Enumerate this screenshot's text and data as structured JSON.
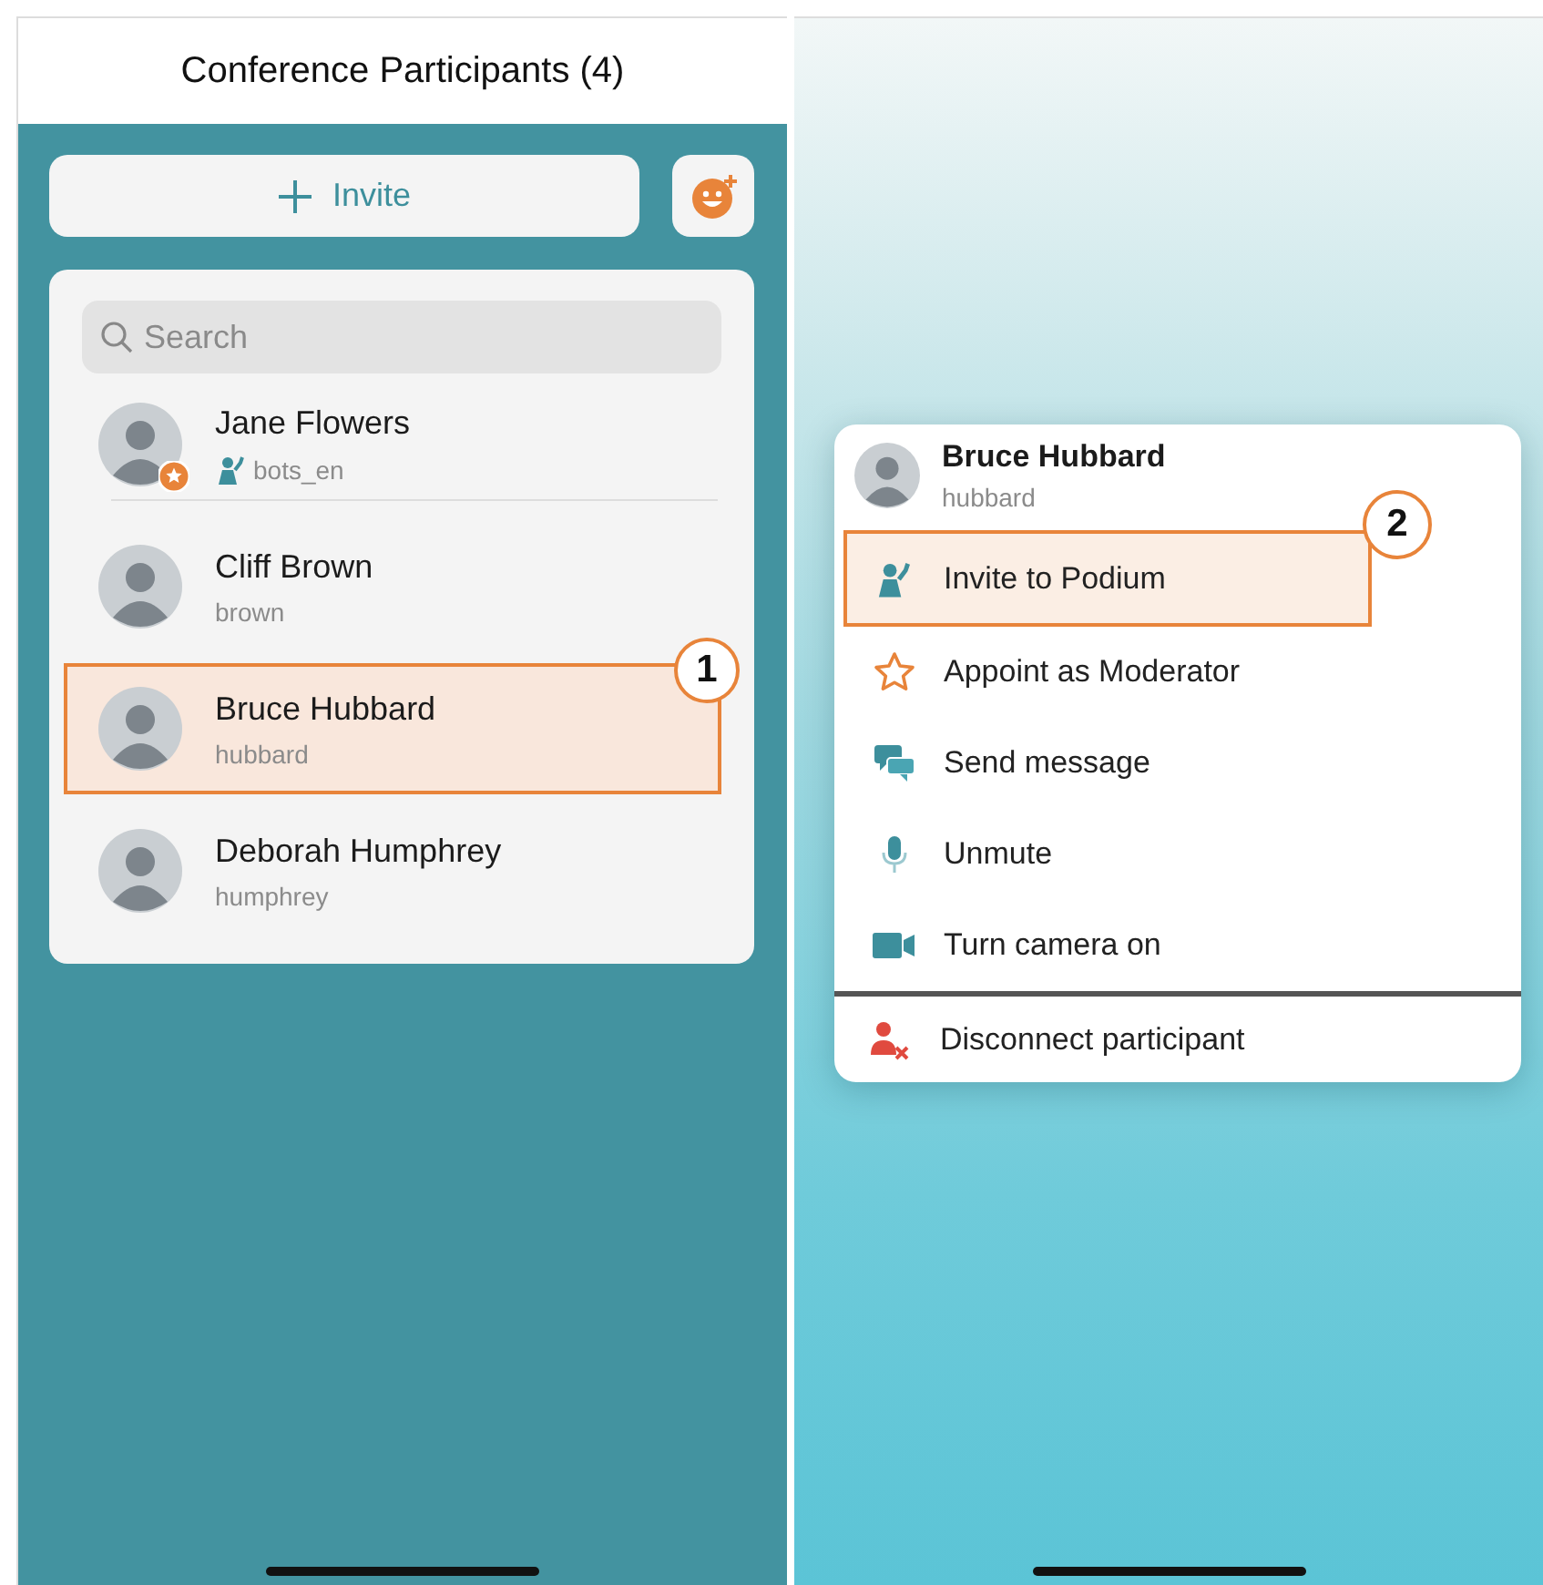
{
  "participants_screen": {
    "title": "Conference Participants (4)",
    "invite_button": {
      "label": "Invite"
    },
    "search": {
      "placeholder": "Search"
    },
    "callout_number": "1",
    "participants": [
      {
        "name": "Jane Flowers",
        "username": "bots_en",
        "moderator": true,
        "on_podium": true,
        "selected": false
      },
      {
        "name": "Cliff Brown",
        "username": "brown",
        "moderator": false,
        "on_podium": false,
        "selected": false
      },
      {
        "name": "Bruce Hubbard",
        "username": "hubbard",
        "moderator": false,
        "on_podium": false,
        "selected": true
      },
      {
        "name": "Deborah Humphrey",
        "username": "humphrey",
        "moderator": false,
        "on_podium": false,
        "selected": false
      }
    ]
  },
  "context_menu": {
    "name": "Bruce Hubbard",
    "username": "hubbard",
    "callout_number": "2",
    "items": [
      {
        "kind": "podium",
        "label": "Invite to Podium",
        "selected": true
      },
      {
        "kind": "moderator",
        "label": "Appoint as Moderator",
        "selected": false
      },
      {
        "kind": "message",
        "label": "Send message",
        "selected": false
      },
      {
        "kind": "mic",
        "label": "Unmute",
        "selected": false
      },
      {
        "kind": "camera",
        "label": "Turn camera on",
        "selected": false
      },
      {
        "kind": "disconnect",
        "label": "Disconnect participant",
        "selected": false
      }
    ]
  }
}
